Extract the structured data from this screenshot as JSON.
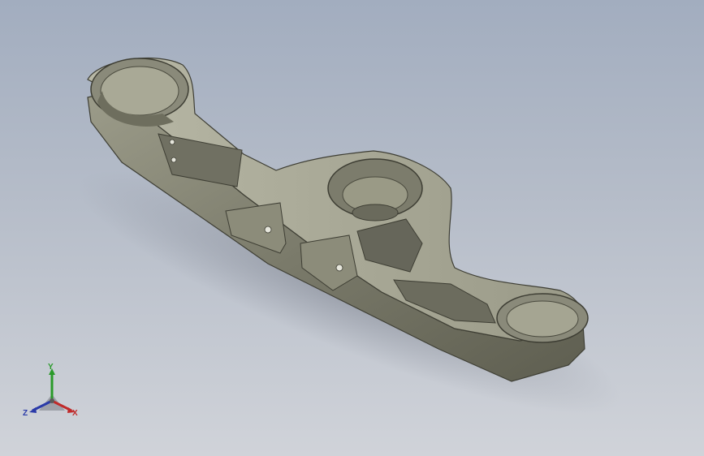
{
  "viewport": {
    "background_top": "#a2adbf",
    "background_bottom": "#d0d3d9",
    "model": "triple-clamp-part",
    "part_color": "#8a8a78"
  },
  "triad": {
    "x_label": "X",
    "y_label": "Y",
    "z_label": "Z",
    "x_color": "#c02a2a",
    "y_color": "#2a9a2a",
    "z_color": "#2a3aa8"
  }
}
